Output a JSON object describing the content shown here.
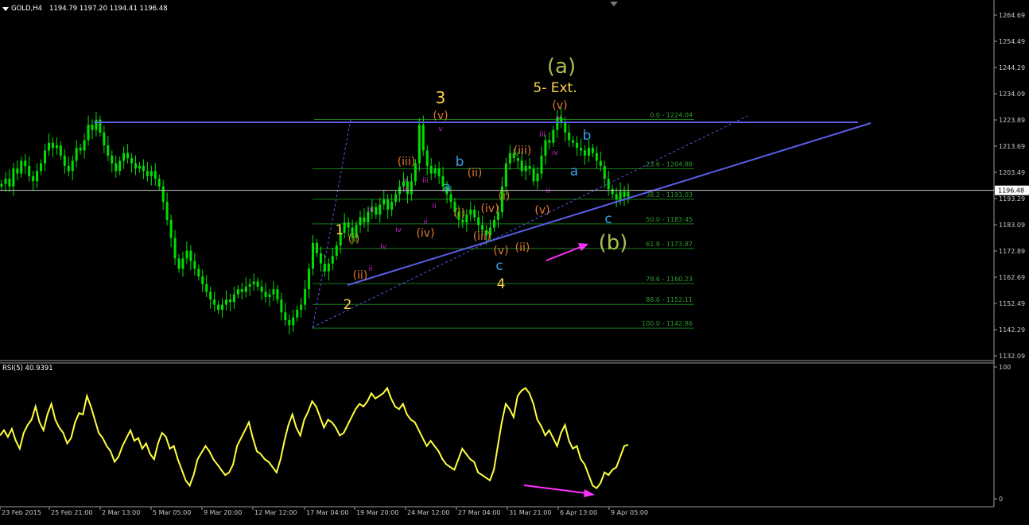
{
  "header": {
    "symbol": "GOLD,H4",
    "ohlc": "1194.79 1197.20 1194.41 1196.48"
  },
  "rsi_header": "RSI(5) 40.9391",
  "colors": {
    "background": "#000000",
    "candle": "#00e000",
    "rsi": "#ffff40",
    "channel": "#5a5ee8",
    "fib": "#1a7a1a",
    "fib_text": "#2f9a2f",
    "orange": "#e07a30",
    "yellow": "#ffd24a",
    "magenta": "#d020d0",
    "cyan": "#3aa0e8",
    "olive": "#a8c050",
    "arrow": "#ff30ff"
  },
  "chart_data": [
    {
      "type": "candlestick",
      "title": "GOLD,H4",
      "ylim": [
        1128,
        1270
      ],
      "x_tick_labels": [
        "23 Feb 2015",
        "25 Feb 21:00",
        "2 Mar 13:00",
        "5 Mar 05:00",
        "9 Mar 20:00",
        "12 Mar 12:00",
        "17 Mar 04:00",
        "19 Mar 20:00",
        "24 Mar 12:00",
        "27 Mar 04:00",
        "31 Mar 21:00",
        "6 Apr 13:00",
        "9 Apr 05:00"
      ],
      "y_tick_labels": [
        "1264.69",
        "1254.49",
        "1244.29",
        "1234.09",
        "1223.89",
        "1213.69",
        "1203.49",
        "1193.29",
        "1183.09",
        "1172.89",
        "1162.69",
        "1152.49",
        "1142.29",
        "1132.09"
      ],
      "current_price": "1196.48",
      "closes": [
        1199,
        1201,
        1198,
        1205,
        1203,
        1208,
        1206,
        1202,
        1200,
        1204,
        1207,
        1212,
        1215,
        1213,
        1214,
        1210,
        1206,
        1204,
        1208,
        1213,
        1212,
        1216,
        1222,
        1220,
        1224,
        1219,
        1214,
        1210,
        1207,
        1204,
        1208,
        1211,
        1209,
        1207,
        1205,
        1206,
        1204,
        1202,
        1204,
        1201,
        1198,
        1192,
        1185,
        1178,
        1170,
        1166,
        1170,
        1173,
        1169,
        1166,
        1163,
        1160,
        1157,
        1154,
        1152,
        1150,
        1152,
        1154,
        1153,
        1156,
        1158,
        1157,
        1159,
        1160,
        1161,
        1159,
        1157,
        1155,
        1156,
        1158,
        1154,
        1149,
        1146,
        1144,
        1147,
        1150,
        1152,
        1158,
        1166,
        1176,
        1172,
        1168,
        1165,
        1168,
        1171,
        1175,
        1180,
        1184,
        1182,
        1178,
        1183,
        1186,
        1184,
        1188,
        1190,
        1187,
        1191,
        1193,
        1189,
        1192,
        1195,
        1198,
        1200,
        1195,
        1200,
        1207,
        1222,
        1212,
        1206,
        1203,
        1205,
        1202,
        1198,
        1195,
        1192,
        1188,
        1185,
        1184,
        1187,
        1189,
        1186,
        1183,
        1181,
        1179,
        1182,
        1185,
        1188,
        1198,
        1207,
        1211,
        1209,
        1208,
        1204,
        1206,
        1205,
        1200,
        1203,
        1210,
        1216,
        1215,
        1220,
        1225,
        1223,
        1219,
        1216,
        1215,
        1213,
        1212,
        1210,
        1213,
        1211,
        1208,
        1206,
        1201,
        1197,
        1195,
        1193,
        1196,
        1194,
        1196
      ],
      "fibonacci": [
        {
          "label": "0.0 - 1224.04",
          "value": 1224.04
        },
        {
          "label": "23.6 - 1204.88",
          "value": 1204.88
        },
        {
          "label": "38.2 - 1193.03",
          "value": 1193.03
        },
        {
          "label": "50.0 - 1183.45",
          "value": 1183.45
        },
        {
          "label": "61.8 - 1173.87",
          "value": 1173.87
        },
        {
          "label": "78.6 - 1160.23",
          "value": 1160.23
        },
        {
          "label": "88.6 - 1152.11",
          "value": 1152.11
        },
        {
          "label": "100.0 - 1142.86",
          "value": 1142.86
        }
      ],
      "wave_labels": [
        {
          "text": "(a)",
          "color": "olive"
        },
        {
          "text": "5- Ext.",
          "color": "yellow"
        },
        {
          "text": "(v)",
          "color": "orange"
        },
        {
          "text": "v",
          "color": "magenta"
        },
        {
          "text": "iii",
          "color": "magenta"
        },
        {
          "text": "iv",
          "color": "magenta"
        },
        {
          "text": "b",
          "color": "cyan"
        },
        {
          "text": "a",
          "color": "cyan"
        },
        {
          "text": "ii",
          "color": "magenta"
        },
        {
          "text": "c",
          "color": "cyan"
        },
        {
          "text": "(b)",
          "color": "olive"
        },
        {
          "text": "(iii)",
          "color": "orange"
        },
        {
          "text": "(i)",
          "color": "orange"
        },
        {
          "text": "(v)",
          "color": "orange"
        },
        {
          "text": "(ii)",
          "color": "orange"
        },
        {
          "text": "(iv)",
          "color": "orange"
        },
        {
          "text": "(iii)",
          "color": "orange"
        },
        {
          "text": "(v)",
          "color": "orange"
        },
        {
          "text": "c",
          "color": "cyan"
        },
        {
          "text": "4",
          "color": "yellow"
        },
        {
          "text": "3",
          "color": "yellow"
        },
        {
          "text": "(v)",
          "color": "orange"
        },
        {
          "text": "v",
          "color": "magenta"
        },
        {
          "text": "b",
          "color": "cyan"
        },
        {
          "text": "a",
          "color": "cyan"
        },
        {
          "text": "(iii)",
          "color": "orange"
        },
        {
          "text": "(ii)",
          "color": "orange"
        },
        {
          "text": "(i)",
          "color": "orange"
        },
        {
          "text": "(iv)",
          "color": "orange"
        },
        {
          "text": "iii",
          "color": "magenta"
        },
        {
          "text": "v",
          "color": "magenta"
        },
        {
          "text": "iv",
          "color": "magenta"
        },
        {
          "text": "ii",
          "color": "magenta"
        },
        {
          "text": "iv",
          "color": "magenta"
        },
        {
          "text": "ii",
          "color": "magenta"
        },
        {
          "text": "iii",
          "color": "magenta"
        },
        {
          "text": "1",
          "color": "yellow"
        },
        {
          "text": "(i)",
          "color": "orange"
        },
        {
          "text": "(ii)",
          "color": "orange"
        },
        {
          "text": "ii",
          "color": "magenta"
        },
        {
          "text": "iv",
          "color": "magenta"
        },
        {
          "text": "2",
          "color": "yellow"
        }
      ]
    },
    {
      "type": "line",
      "title": "RSI(5) 40.9391",
      "ylim": [
        0,
        100
      ],
      "y_tick_labels": [
        "100",
        "0"
      ],
      "values": [
        48,
        52,
        47,
        53,
        44,
        38,
        50,
        56,
        60,
        70,
        58,
        52,
        64,
        72,
        60,
        54,
        50,
        42,
        46,
        58,
        65,
        64,
        78,
        70,
        60,
        50,
        46,
        40,
        36,
        28,
        32,
        40,
        46,
        52,
        44,
        46,
        38,
        42,
        34,
        30,
        42,
        50,
        47,
        38,
        40,
        30,
        22,
        14,
        10,
        18,
        30,
        35,
        40,
        36,
        30,
        26,
        22,
        18,
        20,
        26,
        40,
        46,
        52,
        58,
        46,
        36,
        34,
        30,
        28,
        24,
        20,
        30,
        44,
        56,
        64,
        54,
        48,
        60,
        66,
        74,
        70,
        62,
        54,
        60,
        58,
        54,
        48,
        50,
        56,
        62,
        68,
        72,
        70,
        74,
        80,
        76,
        78,
        80,
        84,
        76,
        70,
        68,
        72,
        64,
        60,
        58,
        52,
        46,
        40,
        44,
        40,
        36,
        30,
        26,
        24,
        22,
        30,
        38,
        34,
        30,
        28,
        20,
        18,
        16,
        14,
        22,
        40,
        58,
        72,
        68,
        62,
        78,
        82,
        84,
        80,
        72,
        60,
        55,
        48,
        52,
        46,
        40,
        50,
        56,
        44,
        38,
        40,
        30,
        26,
        18,
        10,
        8,
        12,
        20,
        18,
        22,
        24,
        32,
        40,
        41
      ]
    }
  ]
}
